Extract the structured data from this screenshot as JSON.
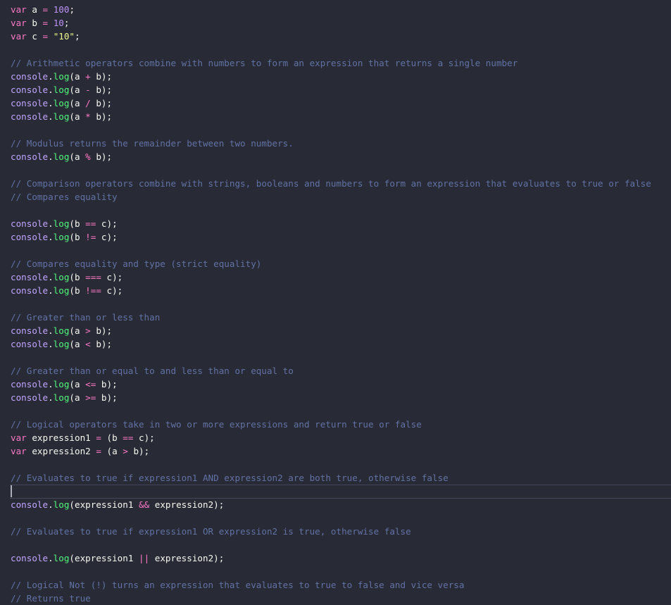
{
  "editor": {
    "lines": [
      {
        "type": "code",
        "tokens": [
          [
            "kw",
            "var"
          ],
          [
            "id",
            " a "
          ],
          [
            "op",
            "="
          ],
          [
            "id",
            " "
          ],
          [
            "num",
            "100"
          ],
          [
            "id",
            ";"
          ]
        ]
      },
      {
        "type": "code",
        "tokens": [
          [
            "kw",
            "var"
          ],
          [
            "id",
            " b "
          ],
          [
            "op",
            "="
          ],
          [
            "id",
            " "
          ],
          [
            "num",
            "10"
          ],
          [
            "id",
            ";"
          ]
        ]
      },
      {
        "type": "code",
        "tokens": [
          [
            "kw",
            "var"
          ],
          [
            "id",
            " c "
          ],
          [
            "op",
            "="
          ],
          [
            "id",
            " "
          ],
          [
            "str",
            "\"10\""
          ],
          [
            "id",
            ";"
          ]
        ]
      },
      {
        "type": "blank"
      },
      {
        "type": "comment",
        "text": "// Arithmetic operators combine with numbers to form an expression that returns a single number"
      },
      {
        "type": "code",
        "tokens": [
          [
            "obj",
            "console"
          ],
          [
            "id",
            "."
          ],
          [
            "fn",
            "log"
          ],
          [
            "id",
            "(a "
          ],
          [
            "op",
            "+"
          ],
          [
            "id",
            " b);"
          ]
        ]
      },
      {
        "type": "code",
        "tokens": [
          [
            "obj",
            "console"
          ],
          [
            "id",
            "."
          ],
          [
            "fn",
            "log"
          ],
          [
            "id",
            "(a "
          ],
          [
            "op",
            "-"
          ],
          [
            "id",
            " b);"
          ]
        ]
      },
      {
        "type": "code",
        "tokens": [
          [
            "obj",
            "console"
          ],
          [
            "id",
            "."
          ],
          [
            "fn",
            "log"
          ],
          [
            "id",
            "(a "
          ],
          [
            "op",
            "/"
          ],
          [
            "id",
            " b);"
          ]
        ]
      },
      {
        "type": "code",
        "tokens": [
          [
            "obj",
            "console"
          ],
          [
            "id",
            "."
          ],
          [
            "fn",
            "log"
          ],
          [
            "id",
            "(a "
          ],
          [
            "op",
            "*"
          ],
          [
            "id",
            " b);"
          ]
        ]
      },
      {
        "type": "blank"
      },
      {
        "type": "comment",
        "text": "// Modulus returns the remainder between two numbers."
      },
      {
        "type": "code",
        "tokens": [
          [
            "obj",
            "console"
          ],
          [
            "id",
            "."
          ],
          [
            "fn",
            "log"
          ],
          [
            "id",
            "(a "
          ],
          [
            "op",
            "%"
          ],
          [
            "id",
            " b);"
          ]
        ]
      },
      {
        "type": "blank"
      },
      {
        "type": "comment",
        "text": "// Comparison operators combine with strings, booleans and numbers to form an expression that evaluates to true or false"
      },
      {
        "type": "comment",
        "text": "// Compares equality"
      },
      {
        "type": "blank"
      },
      {
        "type": "code",
        "tokens": [
          [
            "obj",
            "console"
          ],
          [
            "id",
            "."
          ],
          [
            "fn",
            "log"
          ],
          [
            "id",
            "(b "
          ],
          [
            "op",
            "=="
          ],
          [
            "id",
            " c);"
          ]
        ]
      },
      {
        "type": "code",
        "tokens": [
          [
            "obj",
            "console"
          ],
          [
            "id",
            "."
          ],
          [
            "fn",
            "log"
          ],
          [
            "id",
            "(b "
          ],
          [
            "op",
            "!="
          ],
          [
            "id",
            " c);"
          ]
        ]
      },
      {
        "type": "blank"
      },
      {
        "type": "comment",
        "text": "// Compares equality and type (strict equality)"
      },
      {
        "type": "code",
        "tokens": [
          [
            "obj",
            "console"
          ],
          [
            "id",
            "."
          ],
          [
            "fn",
            "log"
          ],
          [
            "id",
            "(b "
          ],
          [
            "op",
            "==="
          ],
          [
            "id",
            " c);"
          ]
        ]
      },
      {
        "type": "code",
        "tokens": [
          [
            "obj",
            "console"
          ],
          [
            "id",
            "."
          ],
          [
            "fn",
            "log"
          ],
          [
            "id",
            "(b "
          ],
          [
            "op",
            "!=="
          ],
          [
            "id",
            " c);"
          ]
        ]
      },
      {
        "type": "blank"
      },
      {
        "type": "comment",
        "text": "// Greater than or less than"
      },
      {
        "type": "code",
        "tokens": [
          [
            "obj",
            "console"
          ],
          [
            "id",
            "."
          ],
          [
            "fn",
            "log"
          ],
          [
            "id",
            "(a "
          ],
          [
            "op",
            ">"
          ],
          [
            "id",
            " b);"
          ]
        ]
      },
      {
        "type": "code",
        "tokens": [
          [
            "obj",
            "console"
          ],
          [
            "id",
            "."
          ],
          [
            "fn",
            "log"
          ],
          [
            "id",
            "(a "
          ],
          [
            "op",
            "<"
          ],
          [
            "id",
            " b);"
          ]
        ]
      },
      {
        "type": "blank"
      },
      {
        "type": "comment",
        "text": "// Greater than or equal to and less than or equal to"
      },
      {
        "type": "code",
        "tokens": [
          [
            "obj",
            "console"
          ],
          [
            "id",
            "."
          ],
          [
            "fn",
            "log"
          ],
          [
            "id",
            "(a "
          ],
          [
            "op",
            "<="
          ],
          [
            "id",
            " b);"
          ]
        ]
      },
      {
        "type": "code",
        "tokens": [
          [
            "obj",
            "console"
          ],
          [
            "id",
            "."
          ],
          [
            "fn",
            "log"
          ],
          [
            "id",
            "(a "
          ],
          [
            "op",
            ">="
          ],
          [
            "id",
            " b);"
          ]
        ]
      },
      {
        "type": "blank"
      },
      {
        "type": "comment",
        "text": "// Logical operators take in two or more expressions and return true or false"
      },
      {
        "type": "code",
        "tokens": [
          [
            "kw",
            "var"
          ],
          [
            "id",
            " expression1 "
          ],
          [
            "op",
            "="
          ],
          [
            "id",
            " (b "
          ],
          [
            "op",
            "=="
          ],
          [
            "id",
            " c);"
          ]
        ]
      },
      {
        "type": "code",
        "tokens": [
          [
            "kw",
            "var"
          ],
          [
            "id",
            " expression2 "
          ],
          [
            "op",
            "="
          ],
          [
            "id",
            " (a "
          ],
          [
            "op",
            ">"
          ],
          [
            "id",
            " b);"
          ]
        ]
      },
      {
        "type": "blank"
      },
      {
        "type": "comment",
        "text": "// Evaluates to true if expression1 AND expression2 are both true, otherwise false"
      },
      {
        "type": "blank"
      },
      {
        "type": "code",
        "tokens": [
          [
            "obj",
            "console"
          ],
          [
            "id",
            "."
          ],
          [
            "fn",
            "log"
          ],
          [
            "id",
            "(expression1 "
          ],
          [
            "op",
            "&&"
          ],
          [
            "id",
            " expression2);"
          ]
        ]
      },
      {
        "type": "blank"
      },
      {
        "type": "comment",
        "text": "// Evaluates to true if expression1 OR expression2 is true, otherwise false"
      },
      {
        "type": "blank"
      },
      {
        "type": "code",
        "tokens": [
          [
            "obj",
            "console"
          ],
          [
            "id",
            "."
          ],
          [
            "fn",
            "log"
          ],
          [
            "id",
            "(expression1 "
          ],
          [
            "op",
            "||"
          ],
          [
            "id",
            " expression2);"
          ]
        ]
      },
      {
        "type": "blank"
      },
      {
        "type": "comment",
        "text": "// Logical Not (!) turns an expression that evaluates to true to false and vice versa"
      },
      {
        "type": "comment",
        "text": "// Returns true"
      }
    ],
    "cursor_line": 37
  }
}
